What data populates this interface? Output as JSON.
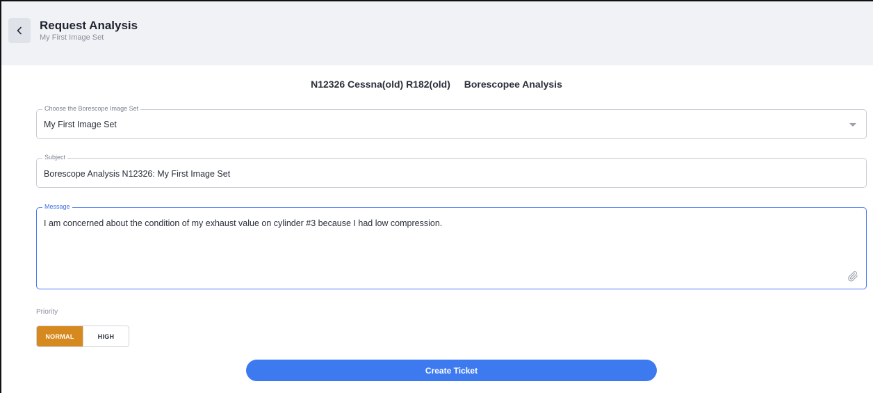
{
  "header": {
    "title": "Request Analysis",
    "subtitle": "My First Image Set",
    "back_icon": "chevron-left-icon"
  },
  "aircraft": {
    "name": "N12326 Cessna(old) R182(old)",
    "analysis_type": "Borescopee Analysis"
  },
  "form": {
    "image_set": {
      "label": "Choose the Borescope Image Set",
      "value": "My First Image Set",
      "icon": "caret-down-icon"
    },
    "subject": {
      "label": "Subject",
      "value": "Borescope Analysis N12326: My First Image Set"
    },
    "message": {
      "label": "Message",
      "value": "I am concerned about the condition  of my exhaust value on cylinder #3 because I had low compression.",
      "attach_icon": "paperclip-icon"
    },
    "priority": {
      "label": "Priority",
      "options": [
        "NORMAL",
        "HIGH"
      ],
      "selected": "NORMAL"
    },
    "submit_label": "Create Ticket"
  },
  "colors": {
    "accent_blue": "#3d7af0",
    "priority_selected": "#d6891f",
    "header_bg": "#f1f2f6"
  }
}
